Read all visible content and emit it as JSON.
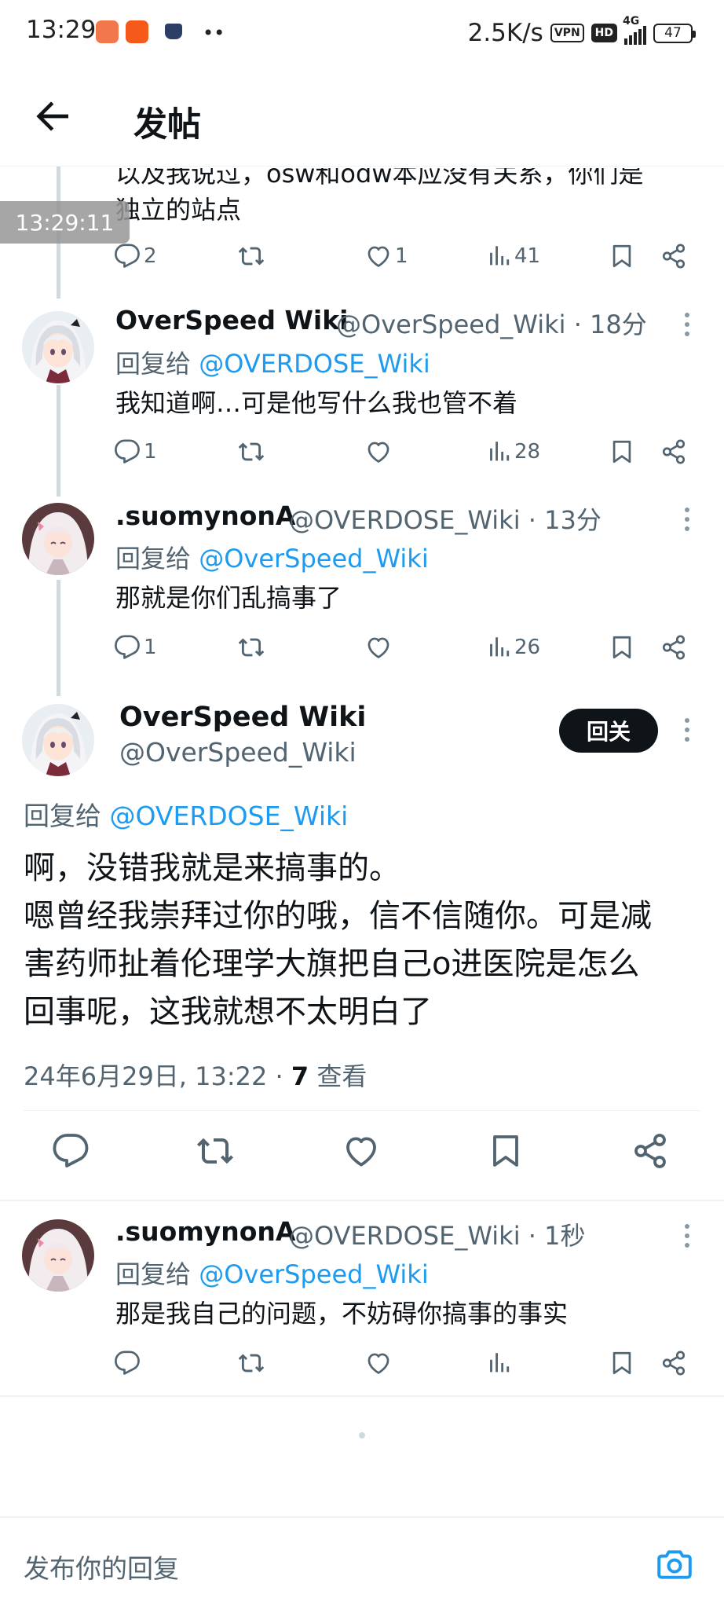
{
  "status_bar": {
    "time": "13:29",
    "speed": "2.5K/s",
    "vpn": "VPN",
    "hd": "HD",
    "network": "4G",
    "battery": "47"
  },
  "header": {
    "title": "发帖"
  },
  "time_overlay": "13:29:11",
  "replies": [
    {
      "truncated_text": "以及我说过，osw和odw本应没有关系，你们是",
      "text": "独立的站点",
      "stats": {
        "replies": "2",
        "retweets": "",
        "likes": "1",
        "views": "41"
      }
    },
    {
      "name": "OverSpeed Wiki",
      "meta": "@OverSpeed_Wiki · 18分",
      "reply_to_label": "回复给",
      "reply_to_handle": "@OVERDOSE_Wiki",
      "text": "我知道啊…可是他写什么我也管不着",
      "stats": {
        "replies": "1",
        "retweets": "",
        "likes": "",
        "views": "28"
      }
    },
    {
      "name": ".suomynonA",
      "meta": "@OVERDOSE_Wiki · 13分",
      "reply_to_label": "回复给",
      "reply_to_handle": "@OverSpeed_Wiki",
      "text": "那就是你们乱搞事了",
      "stats": {
        "replies": "1",
        "retweets": "",
        "likes": "",
        "views": "26"
      }
    }
  ],
  "main_post": {
    "name": "OverSpeed Wiki",
    "handle": "@OverSpeed_Wiki",
    "follow_label": "回关",
    "reply_to_label": "回复给",
    "reply_to_handle": "@OVERDOSE_Wiki",
    "lines": [
      "啊，没错我就是来搞事的。",
      "嗯曾经我崇拜过你的哦，信不信随你。可是减",
      "害药师扯着伦理学大旗把自己o进医院是怎么",
      "回事呢，这我就想不太明白了"
    ],
    "timestamp": "24年6月29日, 13:22 · ",
    "views_count": "7",
    "views_label": " 查看"
  },
  "last_reply": {
    "name": ".suomynonA",
    "meta": "@OVERDOSE_Wiki · 1秒",
    "reply_to_label": "回复给",
    "reply_to_handle": "@OverSpeed_Wiki",
    "text": "那是我自己的问题，不妨碍你搞事的事实"
  },
  "composer": {
    "placeholder": "发布你的回复"
  },
  "icons": [
    "back-arrow-icon",
    "reply-icon",
    "retweet-icon",
    "like-icon",
    "views-icon",
    "bookmark-icon",
    "share-icon",
    "more-icon",
    "camera-icon"
  ],
  "colors": {
    "link": "#1d9bf0",
    "secondary": "#536471",
    "primary": "#0f1419",
    "follow_bg": "#0f1419"
  }
}
